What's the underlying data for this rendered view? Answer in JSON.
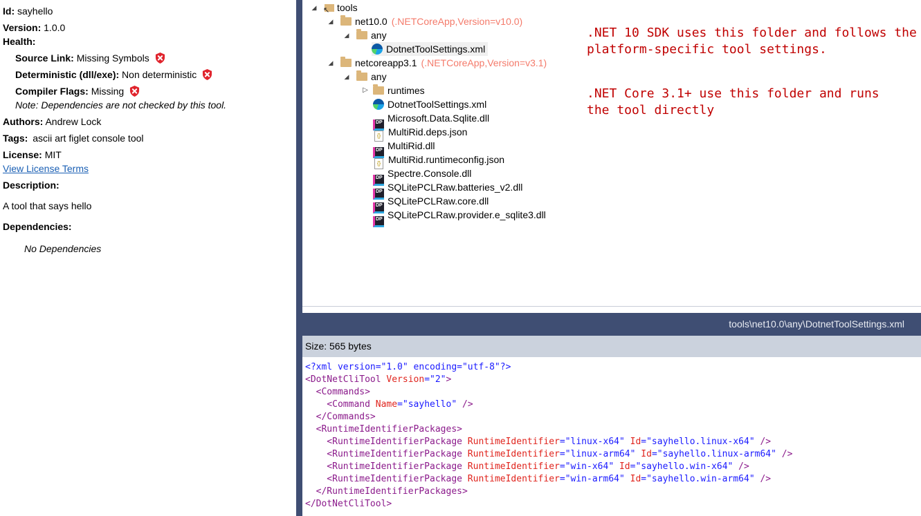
{
  "meta": {
    "id_label": "Id:",
    "id_value": "sayhello",
    "version_label": "Version:",
    "version_value": "1.0.0",
    "health_label": "Health:",
    "source_link_label": "Source Link:",
    "source_link_value": "Missing Symbols",
    "deterministic_label": "Deterministic (dll/exe):",
    "deterministic_value": "Non deterministic",
    "compiler_flags_label": "Compiler Flags:",
    "compiler_flags_value": "Missing",
    "note": "Note: Dependencies are not checked by this tool.",
    "authors_label": "Authors:",
    "authors_value": "Andrew Lock",
    "tags_label": "Tags:",
    "tags_value": "ascii art figlet console tool",
    "license_label": "License:",
    "license_value": "MIT",
    "license_link": "View License Terms",
    "description_label": "Description:",
    "description_value": "A tool that says hello",
    "dependencies_label": "Dependencies:",
    "dependencies_value": "No Dependencies",
    "colors": {
      "error_shield": "#e0242d",
      "link": "#1a5fb4"
    }
  },
  "tree": {
    "root": "tools",
    "net10": "net10.0",
    "net10_tfm": "(.NETCoreApp,Version=v10.0)",
    "any1": "any",
    "file1": "DotnetToolSettings.xml",
    "netcore31": "netcoreapp3.1",
    "netcore31_tfm": "(.NETCoreApp,Version=v3.1)",
    "any2": "any",
    "runtimes": "runtimes",
    "files": [
      "DotnetToolSettings.xml",
      "Microsoft.Data.Sqlite.dll",
      "MultiRid.deps.json",
      "MultiRid.dll",
      "MultiRid.runtimeconfig.json",
      "Spectre.Console.dll",
      "SQLitePCLRaw.batteries_v2.dll",
      "SQLitePCLRaw.core.dll",
      "SQLitePCLRaw.provider.e_sqlite3.dll"
    ],
    "file_icons": [
      "edge-icon",
      "dp-dll-icon",
      "json-icon",
      "dp-dll-icon",
      "json-icon",
      "dp-dll-icon",
      "dp-dll-icon",
      "dp-dll-icon",
      "dp-dll-icon"
    ],
    "annotation1_line1": ".NET 10 SDK uses this folder and follows the",
    "annotation1_line2": "platform-specific tool settings.",
    "annotation2_line1": ".NET Core 3.1+ use this folder and runs",
    "annotation2_line2": "the tool directly",
    "colors": {
      "tfm": "#f47a6a",
      "annotation": "#c00000",
      "folder": "#dcb67a"
    }
  },
  "viewer": {
    "path": "tools\\net10.0\\any\\DotnetToolSettings.xml",
    "size": "Size: 565 bytes",
    "code": {
      "l1": "<?xml version=\"1.0\" encoding=\"utf-8\"?>",
      "l2_tag": "<DotNetCliTool",
      "l2_attr": " Version",
      "l2_eq": "=",
      "l2_val": "\"2\"",
      "l2_end": ">",
      "l3": "  <Commands>",
      "l4_tag": "    <Command",
      "l4_attr": " Name",
      "l4_eq": "=",
      "l4_val": "\"sayhello\"",
      "l4_end": " />",
      "l5": "  </Commands>",
      "l6": "  <RuntimeIdentifierPackages>",
      "pkgs": [
        {
          "rid": "\"linux-x64\"",
          "id": "\"sayhello.linux-x64\""
        },
        {
          "rid": "\"linux-arm64\"",
          "id": "\"sayhello.linux-arm64\""
        },
        {
          "rid": "\"win-x64\"",
          "id": "\"sayhello.win-x64\""
        },
        {
          "rid": "\"win-arm64\"",
          "id": "\"sayhello.win-arm64\""
        }
      ],
      "pkg_tag": "    <RuntimeIdentifierPackage",
      "pkg_attr1": " RuntimeIdentifier",
      "pkg_attr2": " Id",
      "eq": "=",
      "pkg_end": " />",
      "l11": "  </RuntimeIdentifierPackages>",
      "l12": "</DotNetCliTool>"
    }
  }
}
